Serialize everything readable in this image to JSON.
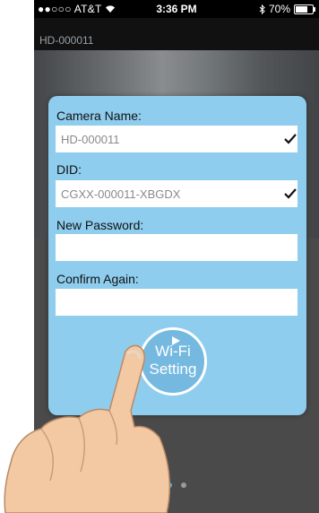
{
  "status_bar": {
    "carrier": "●●○○○ AT&T",
    "time": "3:36 PM",
    "battery": "70%"
  },
  "nav": {
    "title": "HD-000011"
  },
  "form": {
    "camera_name_label": "Camera Name:",
    "camera_name_value": "HD-000011",
    "did_label": "DID:",
    "did_value": "CGXX-000011-XBGDX",
    "new_password_label": "New Password:",
    "new_password_value": "",
    "confirm_label": "Confirm Again:",
    "confirm_value": ""
  },
  "wifi_button": {
    "line1": "Wi-Fi",
    "line2": "Setting"
  },
  "page_indicator": {
    "count": 2,
    "active": 1
  },
  "colors": {
    "dialog": "#8fcdee",
    "dot_active": "#5da7d6",
    "statusbar": "#000000"
  },
  "icons": [
    "wifi-icon",
    "bluetooth-icon",
    "battery-icon",
    "checkmark-icon",
    "play-arrow-icon",
    "pointing-hand-icon"
  ]
}
